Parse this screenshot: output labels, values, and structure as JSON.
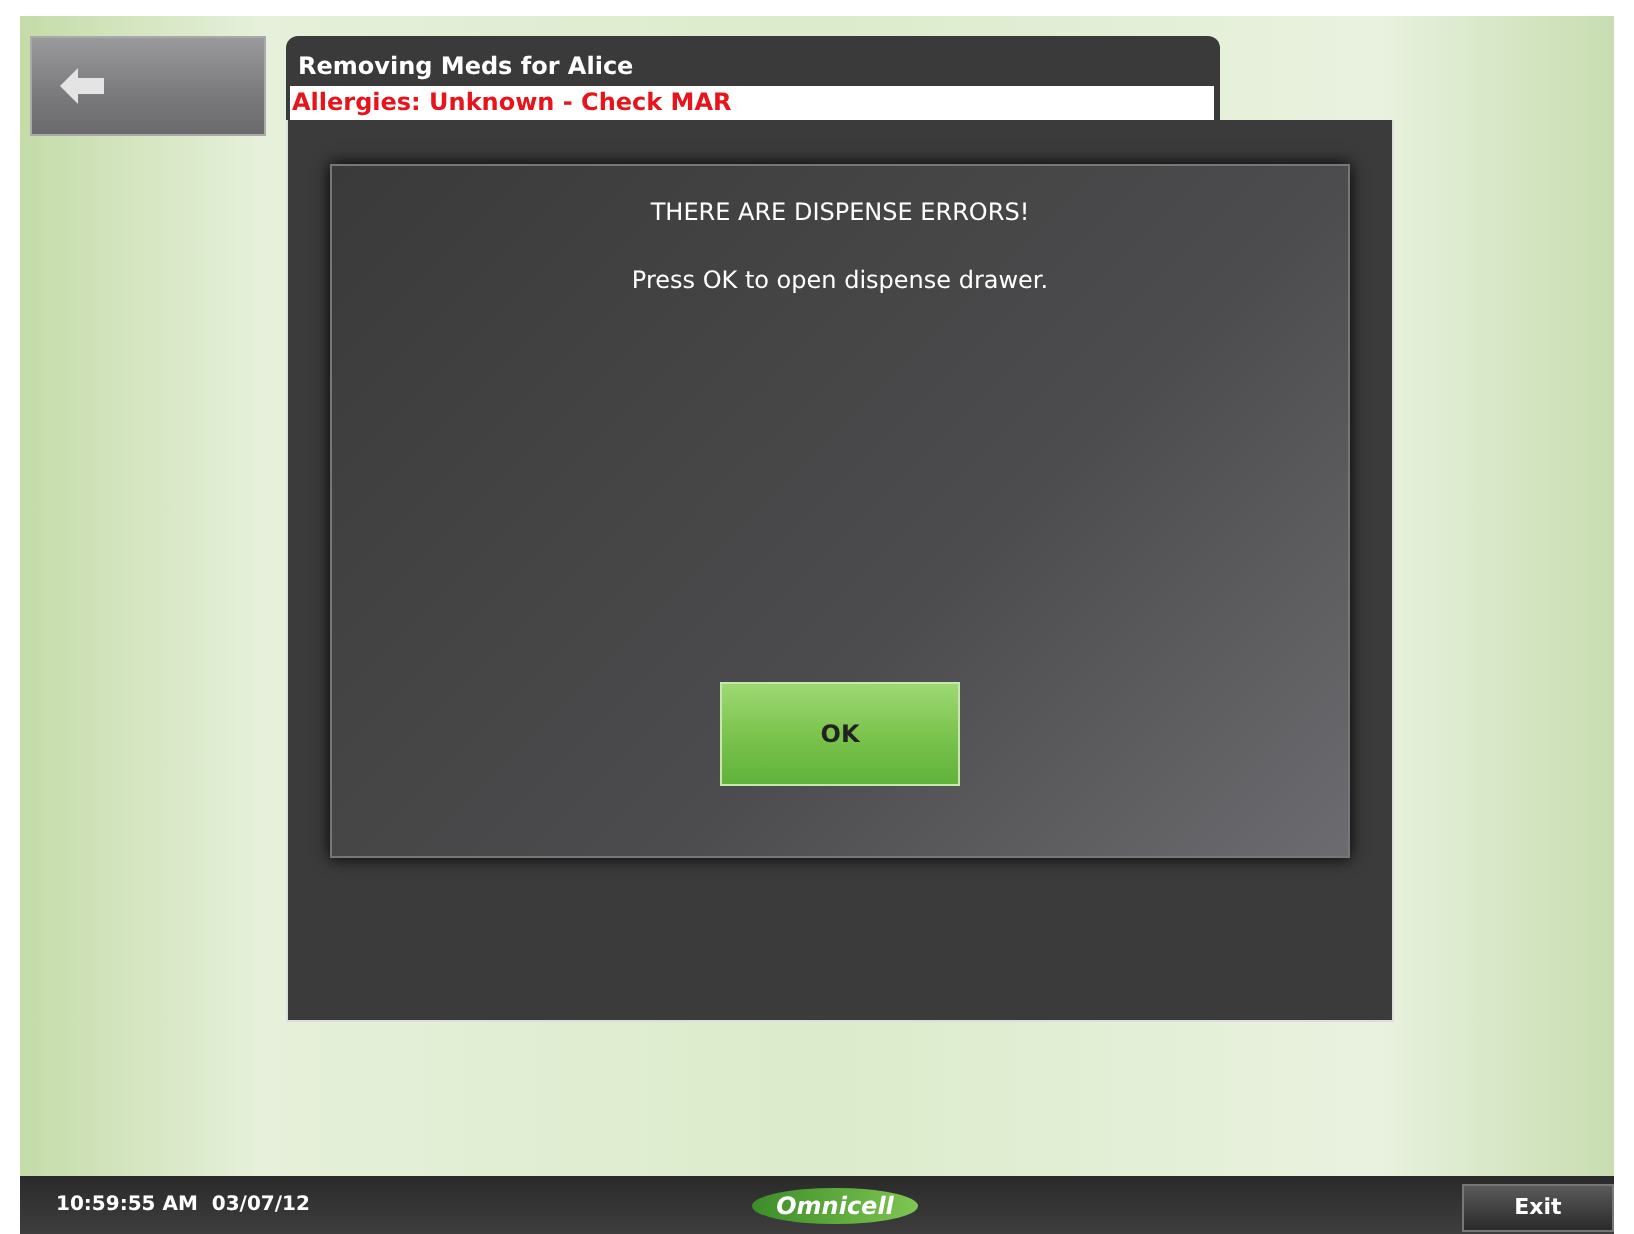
{
  "header": {
    "title": "Removing Meds for Alice",
    "allergies": "Allergies: Unknown - Check MAR"
  },
  "dialog": {
    "heading": "THERE ARE DISPENSE ERRORS!",
    "message": "Press OK to open dispense drawer.",
    "button": "OK"
  },
  "status_bar": {
    "timestamp": "10:59:55 AM  03/07/12",
    "logo": "Omnicell",
    "exit": "Exit"
  }
}
